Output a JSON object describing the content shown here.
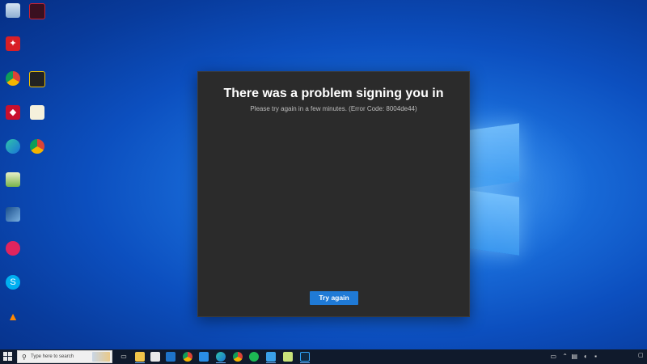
{
  "dialog": {
    "title": "There was a problem signing you in",
    "message": "Please try again in a few minutes. (Error Code: 8004de44)",
    "button_label": "Try again"
  },
  "taskbar": {
    "search_placeholder": "Type here to search"
  },
  "colors": {
    "dialog_background": "#2b2b2b",
    "button_accent": "#1f7ad6",
    "taskbar_background": "#101a2c",
    "wallpaper": "#0c4fbf"
  },
  "desktop_icons": [
    {
      "name": "recycle-bin-icon"
    },
    {
      "name": "app-shortcut-icon"
    },
    {
      "name": "adobe-acrobat-icon"
    },
    {
      "name": "google-chrome-icon"
    },
    {
      "name": "folder-icon"
    },
    {
      "name": "mcafee-icon"
    },
    {
      "name": "document-icon"
    },
    {
      "name": "microsoft-edge-icon"
    },
    {
      "name": "chrome-shortcut-icon"
    },
    {
      "name": "notepad-icon"
    },
    {
      "name": "virtualbox-icon"
    },
    {
      "name": "red-app-icon"
    },
    {
      "name": "skype-icon"
    },
    {
      "name": "vlc-icon"
    }
  ],
  "taskbar_icons": [
    {
      "name": "task-view-icon"
    },
    {
      "name": "file-explorer-icon"
    },
    {
      "name": "store-icon"
    },
    {
      "name": "mail-icon"
    },
    {
      "name": "chrome-icon"
    },
    {
      "name": "vscode-icon"
    },
    {
      "name": "edge-icon"
    },
    {
      "name": "chrome-alt-icon"
    },
    {
      "name": "spotify-icon"
    },
    {
      "name": "app-icon"
    },
    {
      "name": "notepad-icon"
    },
    {
      "name": "photoshop-icon"
    }
  ]
}
